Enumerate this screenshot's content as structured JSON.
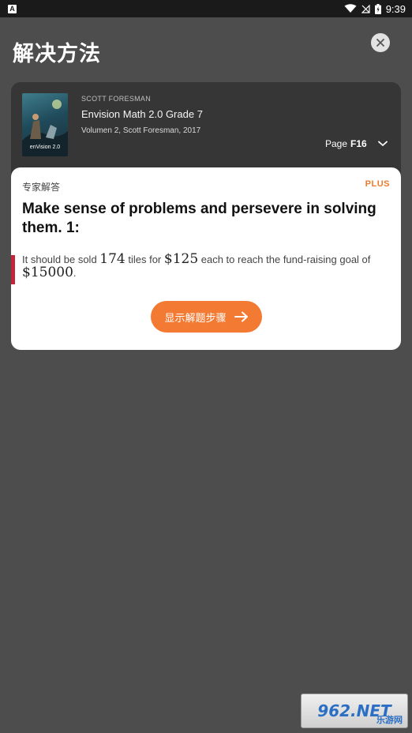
{
  "status_bar": {
    "time": "9:39"
  },
  "header": {
    "title": "解决方法"
  },
  "book": {
    "publisher": "SCOTT FORESMAN",
    "title": "Envision Math 2.0 Grade 7",
    "meta": "Volumen 2, Scott Foresman, 2017",
    "cover_text": "enVision 2.0",
    "page_label": "Page",
    "page_number": "F16"
  },
  "answer": {
    "section_label": "专家解答",
    "badge": "PLUS",
    "question": "Make sense of problems and persevere in solving them. 1:",
    "text_part1": "It should be sold ",
    "math1": "174",
    "text_part2": " tiles for ",
    "math2": "$125",
    "text_part3": " each to reach the fund-raising goal of ",
    "math3": "$15000",
    "text_part4": ".",
    "button_label": "显示解题步骤"
  },
  "watermark": {
    "logo": "962.NET",
    "sub": "乐游网"
  },
  "colors": {
    "accent": "#f37a33",
    "plus": "#f07a2a",
    "answer_bar": "#c4243a"
  }
}
